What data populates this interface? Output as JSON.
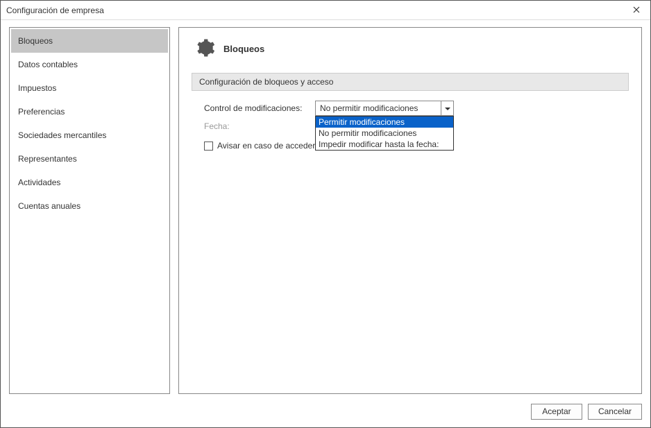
{
  "window": {
    "title": "Configuración de empresa"
  },
  "sidebar": {
    "items": [
      {
        "label": "Bloqueos",
        "selected": true
      },
      {
        "label": "Datos contables",
        "selected": false
      },
      {
        "label": "Impuestos",
        "selected": false
      },
      {
        "label": "Preferencias",
        "selected": false
      },
      {
        "label": "Sociedades mercantiles",
        "selected": false
      },
      {
        "label": "Representantes",
        "selected": false
      },
      {
        "label": "Actividades",
        "selected": false
      },
      {
        "label": "Cuentas anuales",
        "selected": false
      }
    ]
  },
  "content": {
    "title": "Bloqueos",
    "section_header": "Configuración de bloqueos y acceso",
    "control_label": "Control de modificaciones:",
    "control_value": "No permitir modificaciones",
    "control_options": [
      "Permitir modificaciones",
      "No permitir modificaciones",
      "Impedir modificar hasta la fecha:"
    ],
    "control_highlight_index": 0,
    "fecha_label": "Fecha:",
    "checkbox_label": "Avisar en caso de acceder a un ejercicio fuera del año natural"
  },
  "buttons": {
    "accept": "Aceptar",
    "cancel": "Cancelar"
  }
}
